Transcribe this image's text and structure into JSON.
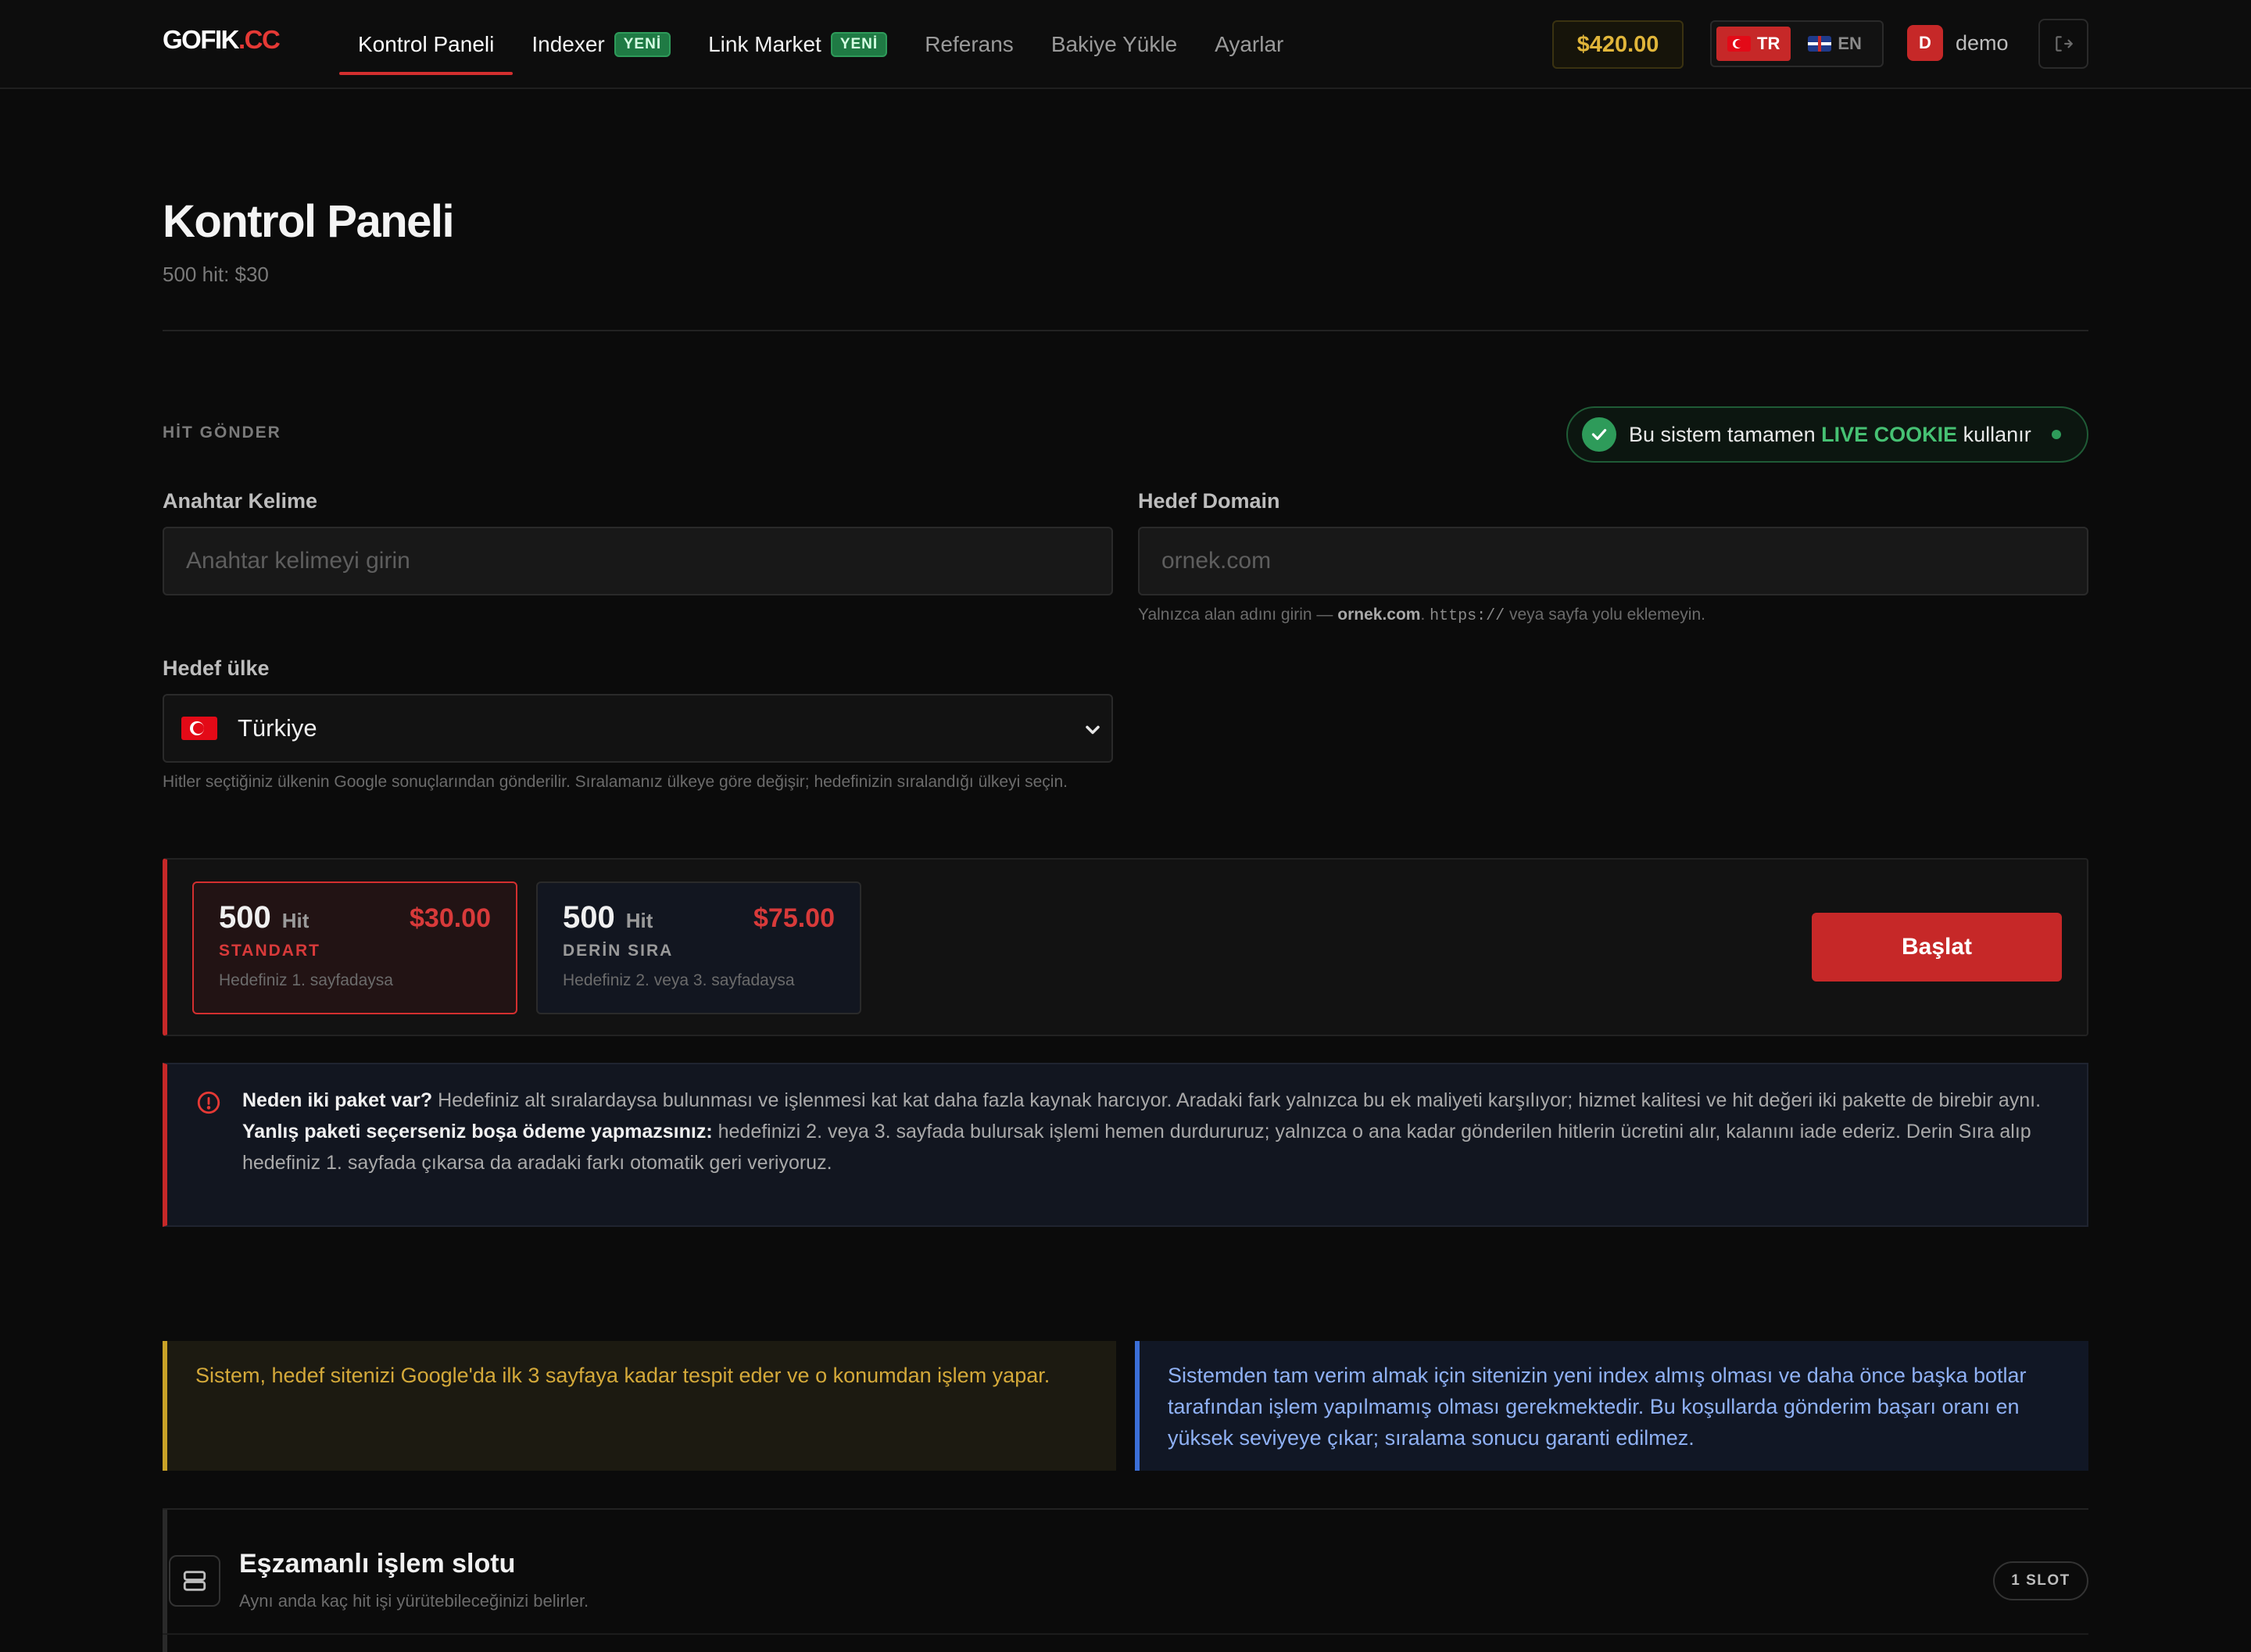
{
  "header": {
    "logo_main": "GOFIK",
    "logo_accent": ".CC",
    "nav": [
      {
        "label": "Kontrol Paneli",
        "active": true,
        "badge": ""
      },
      {
        "label": "Indexer",
        "active": false,
        "badge": "YENİ"
      },
      {
        "label": "Link Market",
        "active": false,
        "badge": "YENİ"
      },
      {
        "label": "Referans",
        "active": false,
        "badge": ""
      },
      {
        "label": "Bakiye Yükle",
        "active": false,
        "badge": ""
      },
      {
        "label": "Ayarlar",
        "active": false,
        "badge": ""
      }
    ],
    "balance": "$420.00",
    "languages": [
      {
        "code": "TR",
        "active": true
      },
      {
        "code": "EN",
        "active": false
      }
    ],
    "user": {
      "initial": "D",
      "name": "demo"
    }
  },
  "page": {
    "title": "Kontrol Paneli",
    "subtitle": "500 hit: $30"
  },
  "form": {
    "section_label": "HİT GÖNDER",
    "live_notice": {
      "prefix": "Bu sistem tamamen",
      "highlight": "LIVE COOKIE",
      "suffix": "kullanır"
    },
    "keyword": {
      "label": "Anahtar Kelime",
      "placeholder": "Anahtar kelimeyi girin",
      "value": ""
    },
    "domain": {
      "label": "Hedef Domain",
      "placeholder": "ornek.com",
      "value": "",
      "hint_prefix": "Yalnızca alan adını girin —",
      "hint_example": "ornek.com",
      "hint_code": "https://",
      "hint_suffix": "veya sayfa yolu eklemeyin."
    },
    "country": {
      "label": "Hedef ülke",
      "selected": "Türkiye",
      "hint": "Hitler seçtiğiniz ülkenin Google sonuçlarından gönderilir. Sıralamanız ülkeye göre değişir; hedefinizin sıralandığı ülkeyi seçin."
    }
  },
  "packages": [
    {
      "count": "500",
      "unit": "Hit",
      "price": "$30.00",
      "kind": "STANDART",
      "desc": "Hedefiniz 1. sayfadaysa",
      "selected": true
    },
    {
      "count": "500",
      "unit": "Hit",
      "price": "$75.00",
      "kind": "DERİN SIRA",
      "desc": "Hedefiniz 2. veya 3. sayfadaysa",
      "selected": false
    }
  ],
  "start_button": "Başlat",
  "info": {
    "q1_bold": "Neden iki paket var?",
    "q1_text": "Hedefiniz alt sıralardaysa bulunması ve işlenmesi kat kat daha fazla kaynak harcıyor. Aradaki fark yalnızca bu ek maliyeti karşılıyor; hizmet kalitesi ve hit değeri iki pakette de birebir aynı.",
    "q2_bold": "Yanlış paketi seçerseniz boşa ödeme yapmazsınız:",
    "q2_text": "hedefinizi 2. veya 3. sayfada bulursak işlemi hemen durdururuz; yalnızca o ana kadar gönderilen hitlerin ücretini alır, kalanını iade ederiz. Derin Sıra alıp hedefiniz 1. sayfada çıkarsa da aradaki farkı otomatik geri veriyoruz."
  },
  "notes": {
    "yellow": "Sistem, hedef sitenizi Google'da ilk 3 sayfaya kadar tespit eder ve o konumdan işlem yapar.",
    "blue": "Sistemden tam verim almak için sitenizin yeni index almış olması ve daha önce başka botlar tarafından işlem yapılmamış olması gerekmektedir. Bu koşullarda gönderim başarı oranı en yüksek seviyeye çıkar; sıralama sonucu garanti edilmez."
  },
  "slot": {
    "title": "Eşzamanlı işlem slotu",
    "subtitle": "Aynı anda kaç hit işi yürütebileceğinizi belirler.",
    "badge": "1 SLOT"
  },
  "colors": {
    "accent": "#c62828",
    "success": "#2e9b5a",
    "balance": "#e0b53a",
    "warning": "#c9a227",
    "info": "#3b6fd8"
  }
}
